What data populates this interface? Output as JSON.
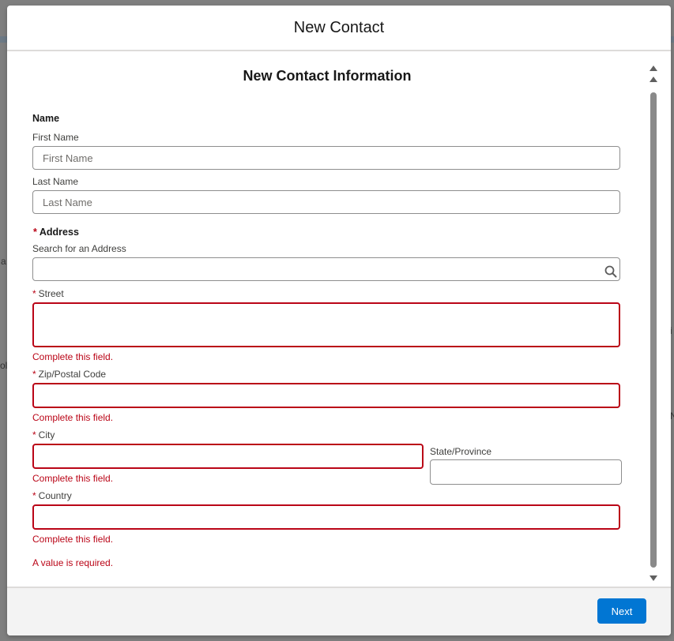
{
  "modal": {
    "title": "New Contact"
  },
  "section": {
    "title": "New Contact Information"
  },
  "name_group": {
    "label": "Name",
    "first_name": {
      "label": "First Name",
      "placeholder": "First Name",
      "value": ""
    },
    "last_name": {
      "label": "Last Name",
      "placeholder": "Last Name",
      "value": ""
    }
  },
  "address_group": {
    "label": "Address",
    "required_marker": "*",
    "search": {
      "label": "Search for an Address",
      "value": "",
      "icon": "search-icon"
    },
    "street": {
      "label": "Street",
      "value": "",
      "error": "Complete this field."
    },
    "zip": {
      "label": "Zip/Postal Code",
      "value": "",
      "error": "Complete this field."
    },
    "city": {
      "label": "City",
      "value": "",
      "error": "Complete this field."
    },
    "state": {
      "label": "State/Province",
      "value": ""
    },
    "country": {
      "label": "Country",
      "value": "",
      "error": "Complete this field."
    }
  },
  "form_error": "A value is required.",
  "footer": {
    "next_label": "Next"
  },
  "background": {
    "chars": [
      "a",
      "oli",
      "i",
      "N"
    ]
  },
  "colors": {
    "accent": "#0176d3",
    "error": "#ba0517",
    "border": "#8e8e8e"
  }
}
